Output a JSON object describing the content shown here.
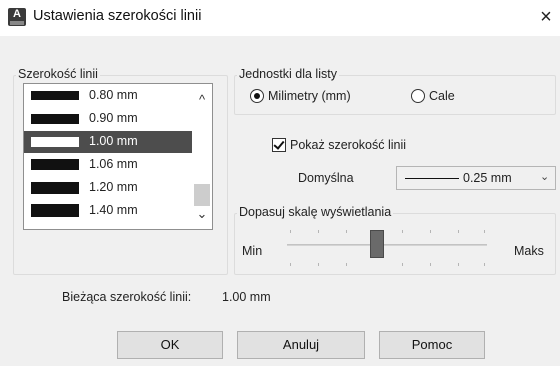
{
  "window": {
    "title": "Ustawienia szerokości linii",
    "icon": "autocad-app-icon",
    "icon_letter": "A",
    "close_glyph": "×"
  },
  "line_width_group": {
    "label": "Szerokość linii",
    "items": [
      {
        "label": "0.80 mm",
        "selected": false
      },
      {
        "label": "0.90 mm",
        "selected": false
      },
      {
        "label": "1.00 mm",
        "selected": true
      },
      {
        "label": "1.06 mm",
        "selected": false
      },
      {
        "label": "1.20 mm",
        "selected": false
      },
      {
        "label": "1.40 mm",
        "selected": false
      }
    ],
    "scroll_up_glyph": "^",
    "scroll_down_glyph": "⌄"
  },
  "units_group": {
    "label": "Jednostki dla listy",
    "options": [
      {
        "label": "Milimetry (mm)",
        "checked": true
      },
      {
        "label": "Cale",
        "checked": false
      }
    ]
  },
  "show_lineweight": {
    "label": "Pokaż szerokość linii",
    "checked": true
  },
  "default_width": {
    "label": "Domyślna",
    "value": "0.25 mm"
  },
  "display_scale": {
    "label": "Dopasuj skalę wyświetlania",
    "min_label": "Min",
    "max_label": "Maks",
    "level": 0.45
  },
  "current": {
    "label": "Bieżąca szerokość linii:",
    "value": "1.00 mm"
  },
  "buttons": {
    "ok": "OK",
    "cancel": "Anuluj",
    "help": "Pomoc"
  },
  "colors": {
    "selection": "#4d4d4d",
    "dialog_bg": "#f0f0f0"
  }
}
